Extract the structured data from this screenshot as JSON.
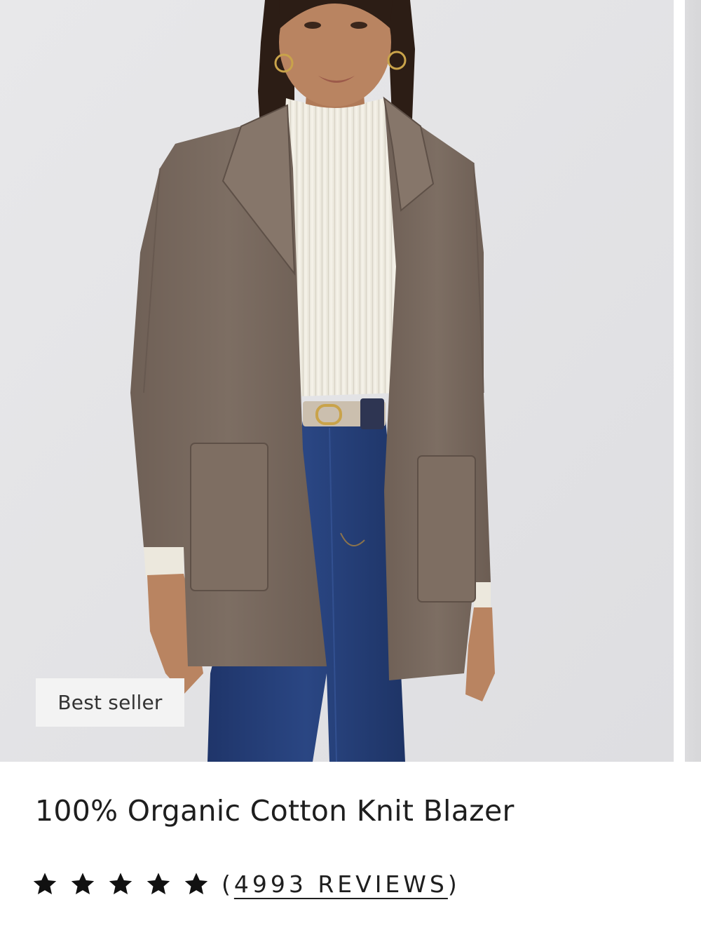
{
  "product_card": {
    "badge": "Best seller",
    "title": "100% Organic Cotton Knit Blazer",
    "rating": {
      "stars": 5,
      "max_stars": 5,
      "open_paren": "(",
      "reviews_text": "4993 REVIEWS",
      "close_paren": ")"
    },
    "icons": {
      "star": "star-icon"
    },
    "colors": {
      "background_photo": "#e4e4e6",
      "blazer": "#7a6a5f",
      "turtleneck": "#f1eee4",
      "jeans": "#27407a",
      "text": "#1e1e1e",
      "badge_bg": "#f3f3f3"
    }
  }
}
